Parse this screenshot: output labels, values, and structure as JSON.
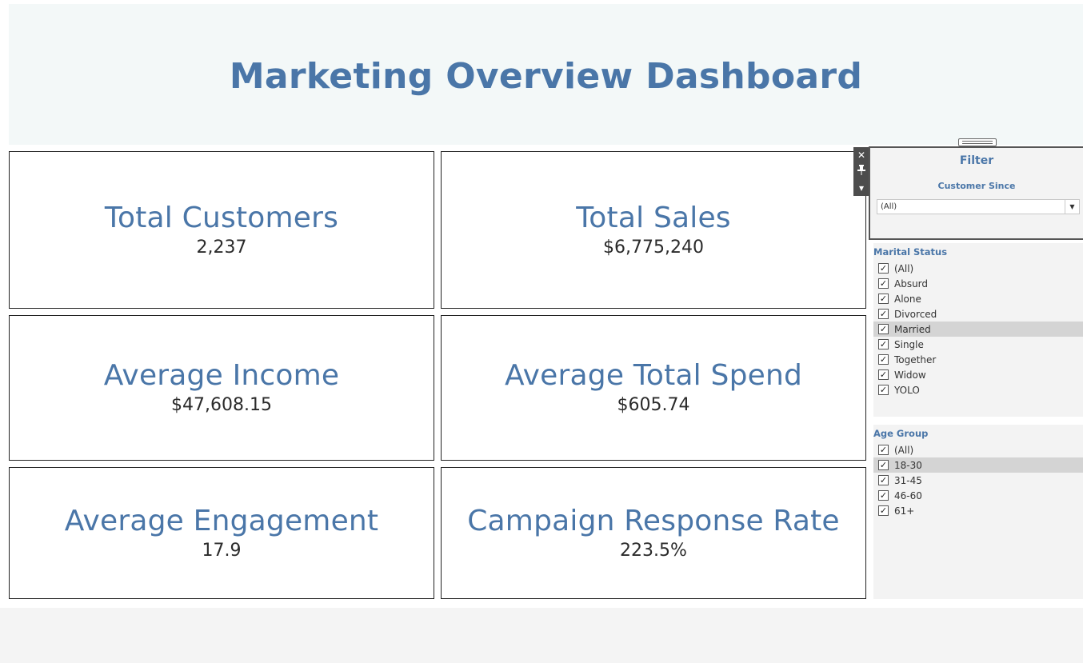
{
  "dashboard": {
    "title": "Marketing Overview Dashboard"
  },
  "kpis": {
    "total_customers": {
      "label": "Total Customers",
      "value": "2,237"
    },
    "total_sales": {
      "label": "Total Sales",
      "value": "$6,775,240"
    },
    "average_income": {
      "label": "Average Income",
      "value": "$47,608.15"
    },
    "average_total_spend": {
      "label": "Average Total Spend",
      "value": "$605.74"
    },
    "average_engagement": {
      "label": "Average Engagement",
      "value": "17.9"
    },
    "campaign_response_rate": {
      "label": "Campaign Response Rate",
      "value": "223.5%"
    }
  },
  "toolbar": {
    "close_icon": "✕",
    "pin_icon": "📌",
    "menu_icon": "▾"
  },
  "filter": {
    "title": "Filter",
    "customer_since": {
      "label": "Customer Since",
      "selected": "(All)"
    },
    "marital_status": {
      "label": "Marital Status",
      "items": [
        {
          "label": "(All)",
          "checked": true
        },
        {
          "label": "Absurd",
          "checked": true
        },
        {
          "label": "Alone",
          "checked": true
        },
        {
          "label": "Divorced",
          "checked": true
        },
        {
          "label": "Married",
          "checked": true,
          "highlighted": true
        },
        {
          "label": "Single",
          "checked": true
        },
        {
          "label": "Together",
          "checked": true
        },
        {
          "label": "Widow",
          "checked": true
        },
        {
          "label": "YOLO",
          "checked": true
        }
      ]
    },
    "age_group": {
      "label": "Age Group",
      "items": [
        {
          "label": "(All)",
          "checked": true
        },
        {
          "label": "18-30",
          "checked": true,
          "highlighted": true
        },
        {
          "label": "31-45",
          "checked": true
        },
        {
          "label": "46-60",
          "checked": true
        },
        {
          "label": "61+",
          "checked": true
        }
      ]
    }
  },
  "colors": {
    "accent": "#4a76a8",
    "header_bg": "#f3f8f8",
    "panel_bg": "#f3f3f3",
    "highlight": "#d4d4d4"
  }
}
